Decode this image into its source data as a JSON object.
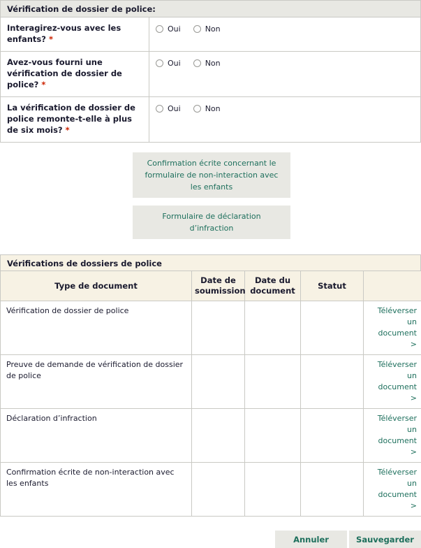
{
  "police_check_section": {
    "title": "Vérification de dossier de police:",
    "required_marker": "*",
    "questions": [
      {
        "label": "Interagirez-vous avec les enfants?",
        "required": true,
        "options": [
          {
            "label": "Oui",
            "selected": false
          },
          {
            "label": "Non",
            "selected": false
          }
        ]
      },
      {
        "label": "Avez-vous fourni une vérification de dossier de police?",
        "required": true,
        "options": [
          {
            "label": "Oui",
            "selected": false
          },
          {
            "label": "Non",
            "selected": false
          }
        ]
      },
      {
        "label": "La vérification de dossier de police remonte-t-elle à plus de six mois?",
        "required": true,
        "options": [
          {
            "label": "Oui",
            "selected": false
          },
          {
            "label": "Non",
            "selected": false
          }
        ]
      }
    ]
  },
  "form_links": [
    {
      "label": "Confirmation écrite concernant le formulaire de non-interaction avec les enfants"
    },
    {
      "label": "Formulaire de déclaration d’infraction"
    }
  ],
  "documents_section": {
    "title": "Vérifications de dossiers de police",
    "columns": [
      "Type de document",
      "Date de soumission",
      "Date du document",
      "Statut",
      ""
    ],
    "action_label": "Téléverser un document >",
    "rows": [
      {
        "type": "Vérification de dossier de police",
        "date_submitted": "",
        "date_document": "",
        "status": "",
        "action": "Téléverser un document >"
      },
      {
        "type": "Preuve de demande de vérification de dossier de police",
        "date_submitted": "",
        "date_document": "",
        "status": "",
        "action": "Téléverser un document >"
      },
      {
        "type": "Déclaration d’infraction",
        "date_submitted": "",
        "date_document": "",
        "status": "",
        "action": "Téléverser un document >"
      },
      {
        "type": "Confirmation écrite de non-interaction avec les enfants",
        "date_submitted": "",
        "date_document": "",
        "status": "",
        "action": "Téléverser un document >"
      }
    ]
  },
  "footer": {
    "cancel_label": "Annuler",
    "save_label": "Sauvegarder"
  },
  "colors": {
    "section_header_bg": "#e8e8e3",
    "table_header_bg": "#f7f2e4",
    "link_green": "#1d6f5c",
    "required_red": "#cc2200",
    "border": "#c9c9c4",
    "text": "#1a1a2e"
  }
}
